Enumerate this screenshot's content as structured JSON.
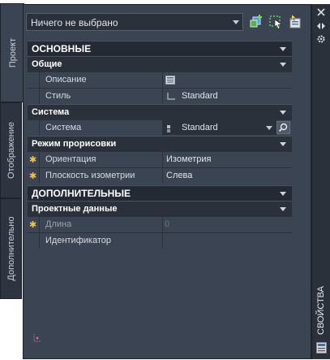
{
  "tabs": [
    {
      "label": "Проект"
    },
    {
      "label": "Отображение"
    },
    {
      "label": "Дополнительно"
    }
  ],
  "selector": {
    "value": "Ничего не выбрано"
  },
  "toolbar": {
    "icons": [
      "add-selection-icon",
      "quick-select-icon",
      "toggle-pickadd-icon"
    ]
  },
  "sections": {
    "basic": {
      "title": "ОСНОВНЫЕ",
      "general": {
        "title": "Общие",
        "rows": [
          {
            "key": "Описание",
            "value": ""
          },
          {
            "key": "Стиль",
            "value": "Standard"
          }
        ]
      },
      "system": {
        "title": "Система",
        "rows": [
          {
            "key": "Система",
            "value": "Standard"
          }
        ]
      },
      "render": {
        "title": "Режим прорисовки",
        "rows": [
          {
            "key": "Ориентация",
            "value": "Изометрия",
            "required": true
          },
          {
            "key": "Плоскость изометрии",
            "value": "Слева",
            "required": true
          }
        ]
      }
    },
    "extra": {
      "title": "ДОПОЛНИТЕЛЬНЫЕ",
      "project": {
        "title": "Проектные данные",
        "rows": [
          {
            "key": "Длина",
            "value": "0",
            "required": true
          },
          {
            "key": "Идентификатор",
            "value": ""
          }
        ]
      }
    }
  },
  "side": {
    "label": "СВОЙСТВА"
  },
  "colors": {
    "panel": "#3b4453",
    "section": "#242a33",
    "accent": "#f4c542"
  }
}
